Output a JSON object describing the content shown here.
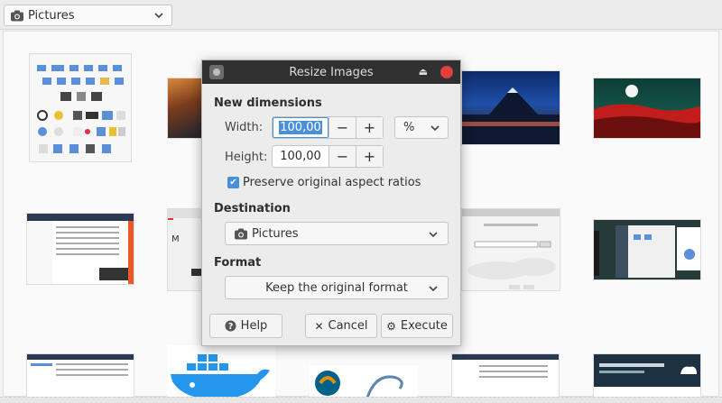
{
  "location": {
    "label": "Pictures",
    "icon": "camera-icon"
  },
  "dialog": {
    "title": "Resize Images",
    "new_dimensions": {
      "title": "New dimensions",
      "width_label": "Width:",
      "width_value": "100,00",
      "height_label": "Height:",
      "height_value": "100,00",
      "minus": "−",
      "plus": "+",
      "unit": "%"
    },
    "preserve_label": "Preserve original aspect ratios",
    "preserve_checked": true,
    "destination": {
      "title": "Destination",
      "value": "Pictures"
    },
    "format": {
      "title": "Format",
      "value": "Keep the original format"
    },
    "buttons": {
      "help": "Help",
      "cancel": "Cancel",
      "execute": "Execute"
    }
  },
  "colors": {
    "accent": "#4a90d9",
    "titlebar": "#303030",
    "close": "#e0403a"
  }
}
